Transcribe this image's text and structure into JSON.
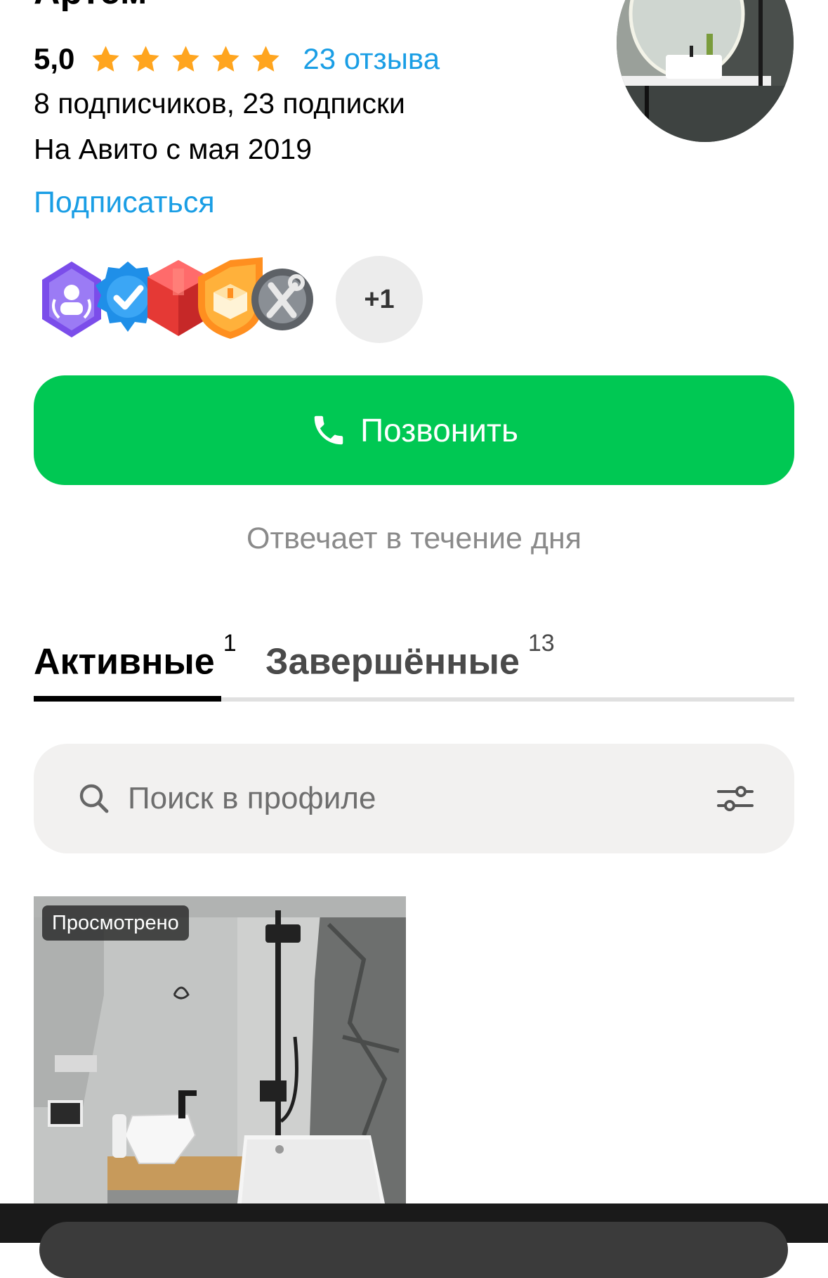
{
  "profile": {
    "name": "Артём",
    "rating": "5,0",
    "stars": 5,
    "reviews_link": "23 отзыва",
    "followers": "8 подписчиков, 23 подписки",
    "since": "На Авито с мая 2019",
    "subscribe_label": "Подписаться"
  },
  "badges": {
    "icons": [
      "community-badge-icon",
      "verified-badge-icon",
      "red-box-badge-icon",
      "orange-box-badge-icon",
      "tools-badge-icon"
    ],
    "more_label": "+1"
  },
  "call_button": {
    "label": "Позвонить",
    "icon": "phone-icon"
  },
  "reply_time": "Отвечает в течение дня",
  "tabs": [
    {
      "label": "Активные",
      "count": "1",
      "active": true
    },
    {
      "label": "Завершённые",
      "count": "13",
      "active": false
    }
  ],
  "search": {
    "placeholder": "Поиск в профиле",
    "icon": "search-icon",
    "filter_icon": "filter-icon"
  },
  "listings": [
    {
      "badge": "Просмотрено",
      "image": "bathroom-photo"
    }
  ],
  "colors": {
    "accent_blue": "#1a9ee5",
    "call_green": "#00c853",
    "star_orange": "#ffa51f"
  }
}
